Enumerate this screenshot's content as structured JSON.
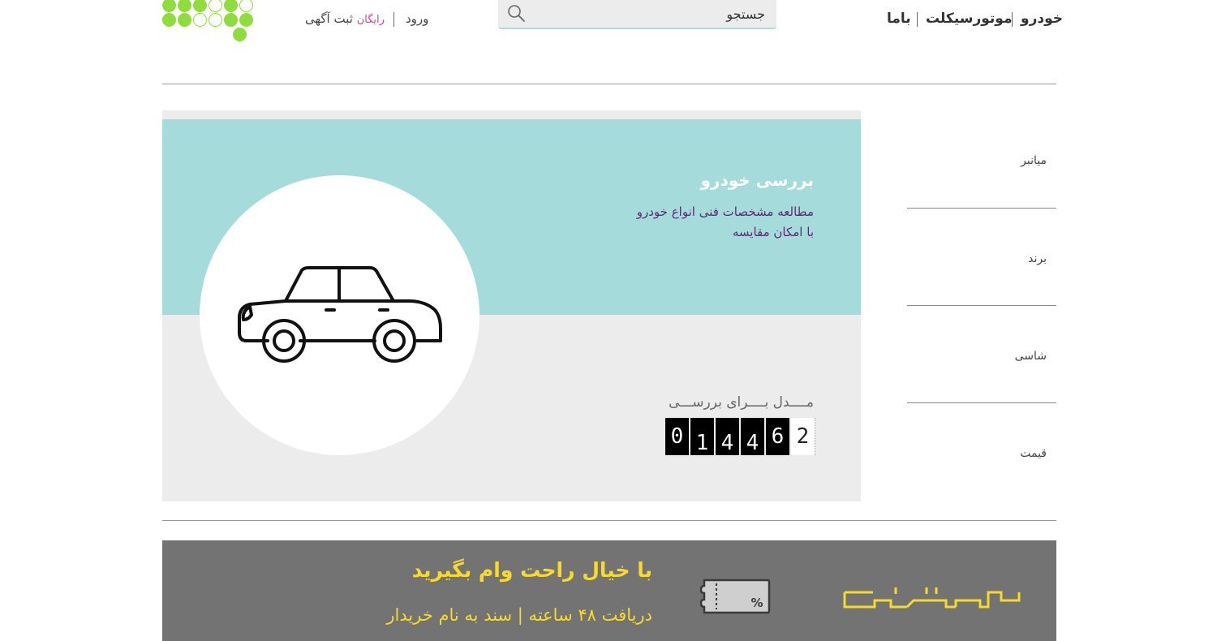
{
  "header": {
    "login_label": "ورود",
    "post_ad_label": "ثبت آگهی",
    "post_ad_free": "رایگان",
    "search": {
      "placeholder": "جستجو"
    },
    "nav": [
      {
        "label": "خودرو"
      },
      {
        "label": "موتورسیکلت"
      },
      {
        "label": "باما"
      }
    ]
  },
  "hero": {
    "title": "بررسی خودرو",
    "description_line1": "مطالعه مشخصات فنی انواع خودرو",
    "description_line2": "با امکان مقایسه",
    "counter_label": "مــــدل بــــرای بررســـی",
    "counter_digits": [
      "0",
      "1",
      "4",
      "4",
      "6",
      "2"
    ],
    "image_icon": "car-icon"
  },
  "sidebar": {
    "items": [
      {
        "label": "میانبر"
      },
      {
        "label": "برند"
      },
      {
        "label": "شاسی"
      },
      {
        "label": "قیمت"
      }
    ]
  },
  "loan_banner": {
    "title": "با خیال راحت وام بگیرید",
    "subtitle": "دریافت ۴۸ ساعته  |  سند به نام خریدار",
    "ticket_text": "%",
    "icons": [
      "ticket-icon",
      "brand-logo"
    ]
  },
  "colors": {
    "teal": "#a6dbdb",
    "panel_gray": "#ececec",
    "banner_gray": "#737373",
    "accent_yellow": "#f7da2a",
    "logo_green": "#8fdc3d",
    "free_magenta": "#d63ea0",
    "description_purple": "#5a2d73"
  }
}
